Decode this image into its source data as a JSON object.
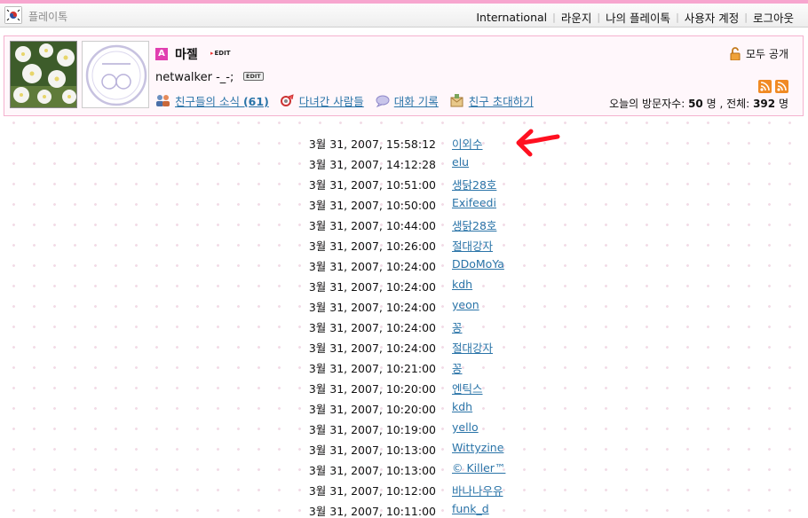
{
  "topbar": {
    "brand": "플레이톡",
    "nav": [
      "International",
      "라운지",
      "나의 플레이톡",
      "사용자 계정",
      "로그아웃"
    ]
  },
  "profile": {
    "grade": "A",
    "name": "마젤",
    "edit_label": "EDIT",
    "status_message": "netwalker -_-;",
    "status_edit_label": "EDIT",
    "links": [
      {
        "label": "친구들의 소식",
        "count": "(61)",
        "icon": "friends-icon"
      },
      {
        "label": "다녀간 사람들",
        "icon": "visitors-icon"
      },
      {
        "label": "대화 기록",
        "icon": "chat-history-icon"
      },
      {
        "label": "친구 초대하기",
        "icon": "invite-icon"
      }
    ],
    "privacy": "모두 공개",
    "visitors_today_label": "오늘의 방문자수:",
    "visitors_today": "50",
    "visitors_unit": "명",
    "visitors_total_label": ", 전체:",
    "visitors_total": "392",
    "visitors_total_unit": "명"
  },
  "visitor_log": [
    {
      "time": "3월 31, 2007, 15:58:12",
      "name": "이외수"
    },
    {
      "time": "3월 31, 2007, 14:12:28",
      "name": "elu"
    },
    {
      "time": "3월 31, 2007, 10:51:00",
      "name": "생닭28호"
    },
    {
      "time": "3월 31, 2007, 10:50:00",
      "name": "Exifeedi"
    },
    {
      "time": "3월 31, 2007, 10:44:00",
      "name": "생닭28호"
    },
    {
      "time": "3월 31, 2007, 10:26:00",
      "name": "절대강자"
    },
    {
      "time": "3월 31, 2007, 10:24:00",
      "name": "DDoMoYa"
    },
    {
      "time": "3월 31, 2007, 10:24:00",
      "name": "kdh"
    },
    {
      "time": "3월 31, 2007, 10:24:00",
      "name": "yeon"
    },
    {
      "time": "3월 31, 2007, 10:24:00",
      "name": "꽁"
    },
    {
      "time": "3월 31, 2007, 10:24:00",
      "name": "절대강자"
    },
    {
      "time": "3월 31, 2007, 10:21:00",
      "name": "꽁"
    },
    {
      "time": "3월 31, 2007, 10:20:00",
      "name": "엔틱스"
    },
    {
      "time": "3월 31, 2007, 10:20:00",
      "name": "kdh"
    },
    {
      "time": "3월 31, 2007, 10:19:00",
      "name": "yello"
    },
    {
      "time": "3월 31, 2007, 10:13:00",
      "name": "Wittyzine"
    },
    {
      "time": "3월 31, 2007, 10:13:00",
      "name": "© Killer™"
    },
    {
      "time": "3월 31, 2007, 10:12:00",
      "name": "바나나우유"
    },
    {
      "time": "3월 31, 2007, 10:11:00",
      "name": "funk_d"
    }
  ],
  "colors": {
    "accent_pink": "#f7a6cf",
    "link_blue": "#2a74a8",
    "arrow_red": "#ff1020"
  }
}
